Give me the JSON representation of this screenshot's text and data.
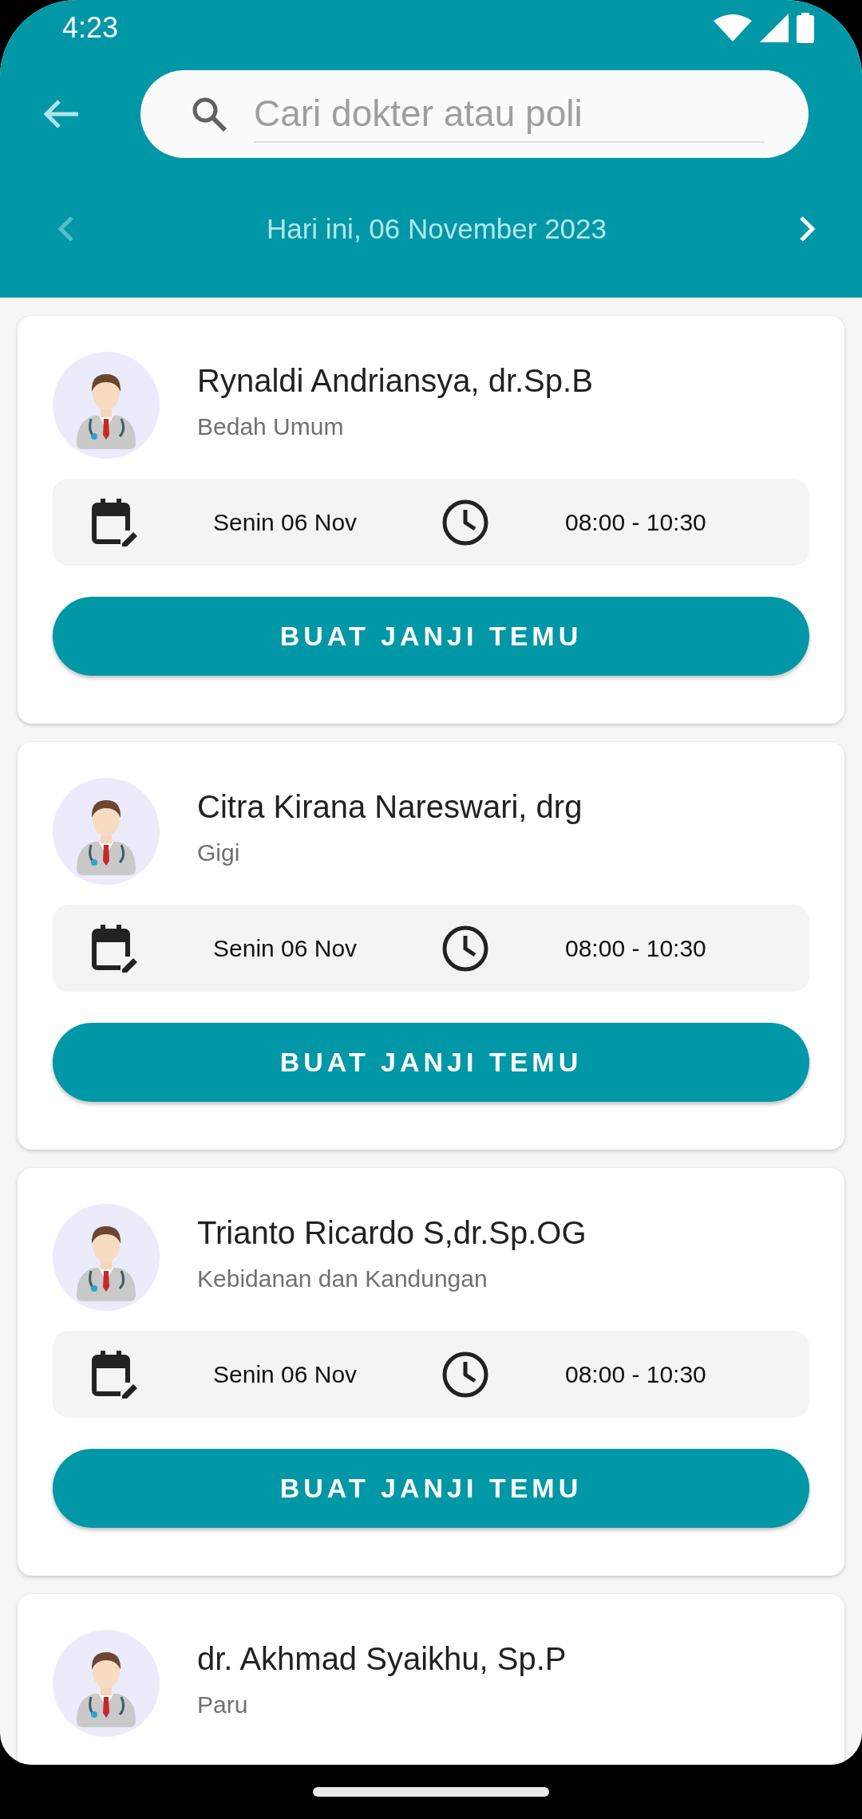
{
  "status_bar": {
    "time": "4:23"
  },
  "search": {
    "placeholder": "Cari dokter atau poli"
  },
  "date_nav": {
    "label": "Hari ini, 06 November 2023",
    "prev_disabled": true,
    "next_disabled": false
  },
  "doctors": [
    {
      "name": "Rynaldi Andriansya, dr.Sp.B",
      "specialty": "Bedah Umum",
      "day": "Senin 06 Nov",
      "hours": "08:00 - 10:30",
      "button": "BUAT JANJI TEMU"
    },
    {
      "name": "Citra Kirana Nareswari, drg",
      "specialty": "Gigi",
      "day": "Senin 06 Nov",
      "hours": "08:00 - 10:30",
      "button": "BUAT JANJI TEMU"
    },
    {
      "name": "Trianto Ricardo S,dr.Sp.OG",
      "specialty": "Kebidanan dan Kandungan",
      "day": "Senin 06 Nov",
      "hours": "08:00 - 10:30",
      "button": "BUAT JANJI TEMU"
    },
    {
      "name": "dr. Akhmad Syaikhu, Sp.P",
      "specialty": "Paru"
    }
  ]
}
